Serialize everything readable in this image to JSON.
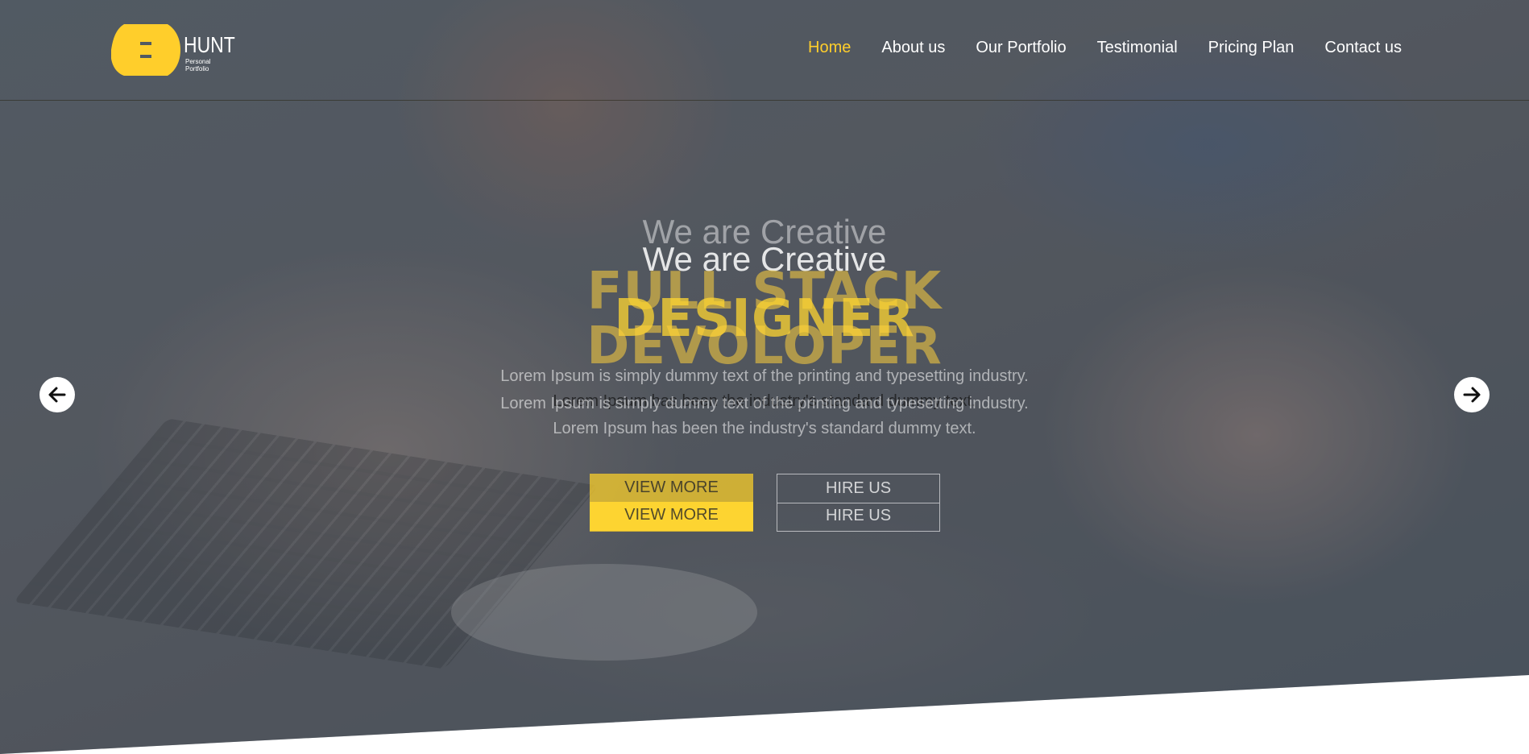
{
  "brand": {
    "name": "HUNT",
    "tagline": "Personal Portfolio",
    "accent": "#ffce2b"
  },
  "nav": {
    "items": [
      {
        "label": "Home",
        "active": true
      },
      {
        "label": "About us"
      },
      {
        "label": "Our Portfolio"
      },
      {
        "label": "Testimonial"
      },
      {
        "label": "Pricing Plan"
      },
      {
        "label": "Contact us"
      }
    ]
  },
  "slider": {
    "slides": [
      {
        "subtitle": "We are Creative",
        "title_line1": "FULL STACK",
        "title_line2": "DEVOLOPER",
        "text_line1": "Lorem Ipsum is simply dummy text of the printing and typesetting industry.",
        "text_line2": "Lorem Ipsum has been the industry's standard dummy text."
      },
      {
        "subtitle": "We are Creative",
        "title_line1": "DESIGNER",
        "text_line1": "Lorem Ipsum is simply dummy text of the printing and typesetting industry.",
        "text_line2": "Lorem Ipsum has been the industry's standard dummy text."
      }
    ],
    "primary_button": "VIEW MORE",
    "secondary_button": "HIRE US",
    "prev_icon": "arrow-left-icon",
    "next_icon": "arrow-right-icon"
  }
}
